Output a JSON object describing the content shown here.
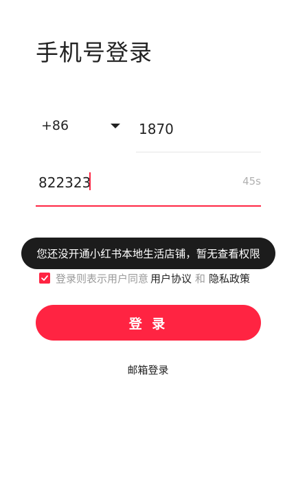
{
  "header": {
    "title": "手机号登录"
  },
  "phone": {
    "country_code": "+86",
    "value": "1870",
    "dropdown_icon": "caret-down-icon"
  },
  "code": {
    "value": "822323",
    "countdown": "45s"
  },
  "toast": {
    "message": "您还没开通小红书本地生活店铺，暂无查看权限"
  },
  "agreement": {
    "checked": true,
    "prefix": "登录则表示用户同意",
    "user_agreement": "用户协议",
    "and": "和",
    "privacy_policy": "隐私政策"
  },
  "actions": {
    "login_label": "登 录",
    "email_login": "邮箱登录"
  },
  "colors": {
    "accent": "#ff2442",
    "toast_bg": "#1c1c1c",
    "muted": "#9a9a9a"
  }
}
